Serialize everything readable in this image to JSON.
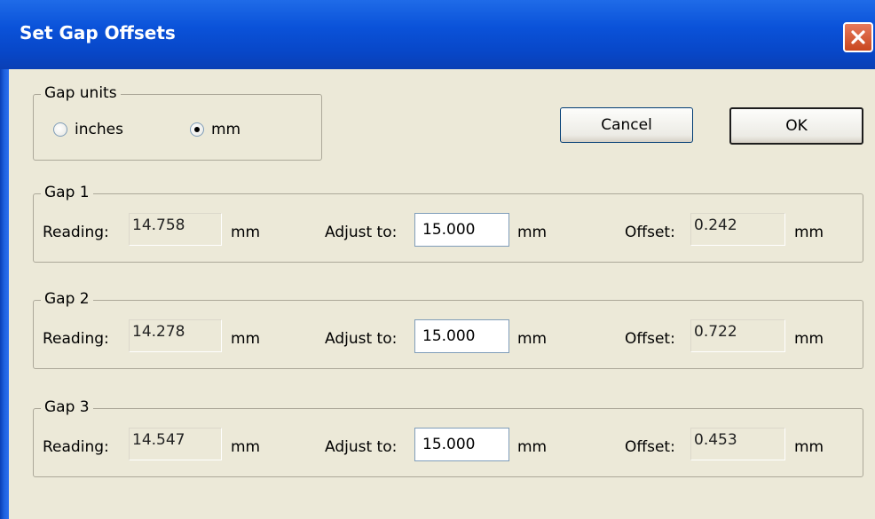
{
  "window": {
    "title": "Set Gap Offsets",
    "close_icon": "close-icon"
  },
  "gap_units": {
    "legend": "Gap units",
    "options": [
      {
        "label": "inches",
        "selected": false
      },
      {
        "label": "mm",
        "selected": true
      }
    ]
  },
  "buttons": {
    "cancel": "Cancel",
    "ok": "OK"
  },
  "labels": {
    "reading": "Reading:",
    "adjust_to": "Adjust to:",
    "offset": "Offset:",
    "unit": "mm"
  },
  "gaps": [
    {
      "legend": "Gap 1",
      "reading": "14.758",
      "adjust_to": "15.000",
      "offset": "0.242"
    },
    {
      "legend": "Gap 2",
      "reading": "14.278",
      "adjust_to": "15.000",
      "offset": "0.722"
    },
    {
      "legend": "Gap 3",
      "reading": "14.547",
      "adjust_to": "15.000",
      "offset": "0.453"
    }
  ]
}
